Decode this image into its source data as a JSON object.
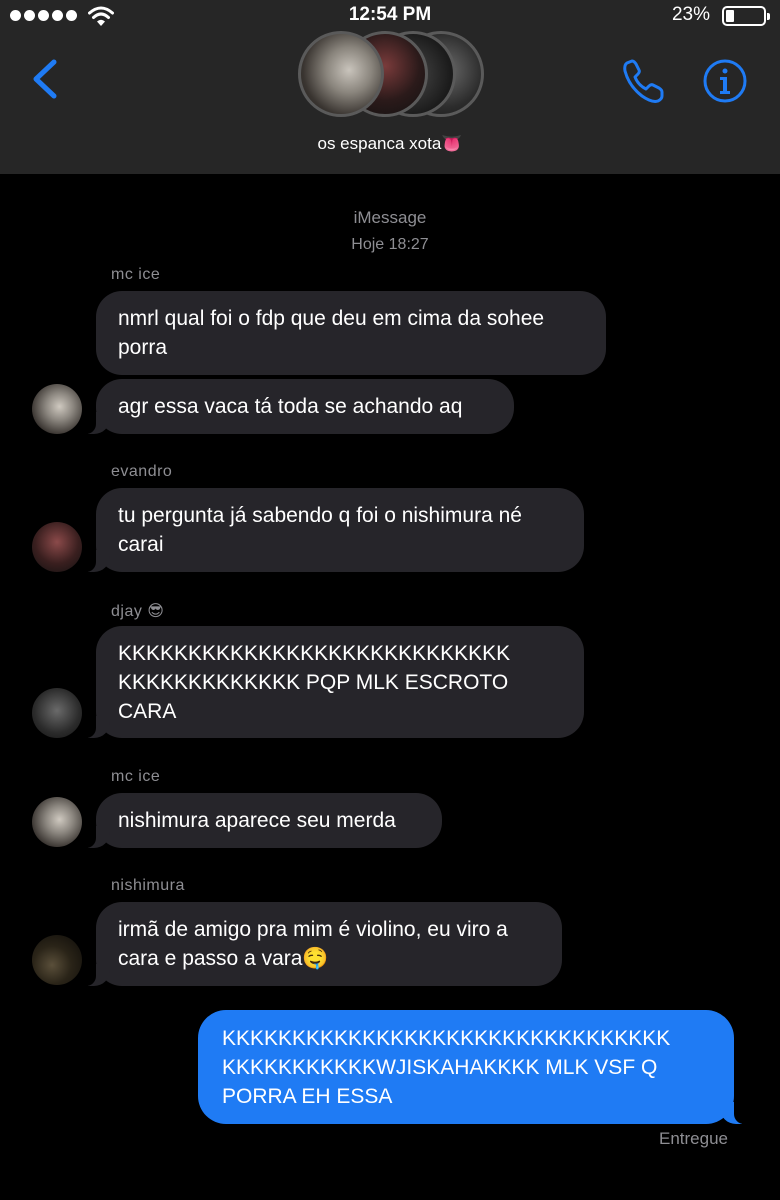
{
  "status_bar": {
    "time": "12:54 PM",
    "battery_percent": "23%",
    "battery_level": 0.23,
    "signal_bars": 5,
    "wifi_icon": "wifi-icon"
  },
  "header": {
    "group_name": "os espanca xota👅",
    "back_icon": "chevron-left-icon",
    "call_icon": "phone-icon",
    "info_icon": "info-icon",
    "accent_color": "#1f7bf4"
  },
  "chat": {
    "service_label": "iMessage",
    "timestamp": "Hoje 18:27",
    "messages": [
      {
        "sender": "mc ice",
        "text": "nmrl qual foi o fdp que deu em cima da sohee\nporra"
      },
      {
        "text": "agr essa vaca tá toda se achando aq"
      },
      {
        "sender": "evandro",
        "text": "tu pergunta já sabendo q foi o nishimura né\ncarai"
      },
      {
        "sender": "djay 😎",
        "text": "KKKKKKKKKKKKKKKKKKKKKKKKKKKK\nKKKKKKKKKKKKK PQP MLK ESCROTO\nCARA"
      },
      {
        "sender": "mc ice",
        "text": "nishimura aparece seu merda"
      },
      {
        "sender": "nishimura",
        "text": "irmã de amigo pra mim é violino, eu viro a\ncara e passo a vara🤤"
      },
      {
        "text": "KKKKKKKKKKKKKKKKKKKKKKKKKKKKKKKK\nKKKKKKKKKKKWJISKAHAKKKK MLK VSF Q\nPORRA EH ESSA"
      }
    ],
    "delivered_label": "Entregue",
    "incoming_bubble_color": "#26252a",
    "outgoing_bubble_color": "#1f7bf4"
  }
}
